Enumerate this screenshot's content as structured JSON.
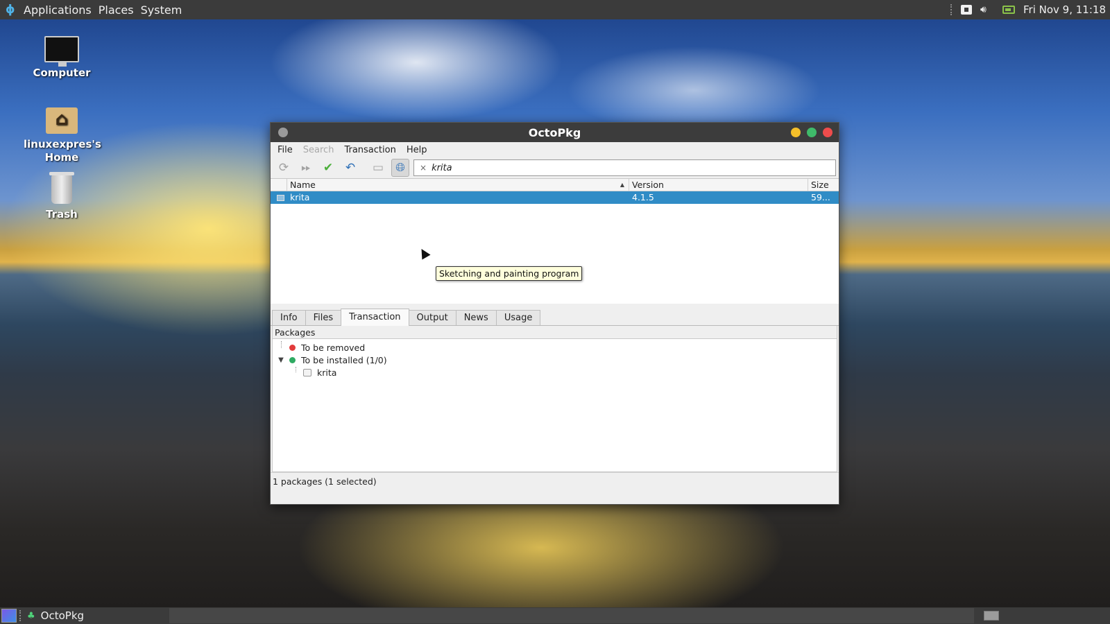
{
  "top_panel": {
    "menus": [
      "Applications",
      "Places",
      "System"
    ],
    "clock": "Fri Nov  9, 11:18",
    "icons": [
      "gecko-logo-icon",
      "notification-icon",
      "volume-icon",
      "battery-icon"
    ]
  },
  "desktop": {
    "icons": [
      {
        "label": "Computer",
        "icon": "computer-icon"
      },
      {
        "label": "linuxexpres's Home",
        "icon": "home-folder-icon"
      },
      {
        "label": "Trash",
        "icon": "trash-icon"
      }
    ]
  },
  "window": {
    "title": "OctoPkg",
    "menu": {
      "file": "File",
      "search": "Search",
      "transaction": "Transaction",
      "help": "Help"
    },
    "toolbar": {
      "icons": [
        "sync-icon",
        "stop-icon",
        "commit-icon",
        "rollback-icon",
        "terminal-icon",
        "aur-globe-icon"
      ],
      "search_value": "krita",
      "clear_symbol": "×"
    },
    "table": {
      "columns": {
        "name": "Name",
        "version": "Version",
        "size": "Size"
      },
      "rows": [
        {
          "name": "krita",
          "version": "4.1.5",
          "size": "59..."
        }
      ]
    },
    "tooltip": "Sketching and painting program",
    "tabs": [
      "Info",
      "Files",
      "Transaction",
      "Output",
      "News",
      "Usage"
    ],
    "active_tab": "Transaction",
    "transaction_pane": {
      "title": "Packages",
      "to_remove": "To be removed",
      "to_install": "To be installed (1/0)",
      "install_items": [
        "krita"
      ]
    },
    "status": "1 packages (1 selected)"
  },
  "taskbar": {
    "task_label": "OctoPkg"
  },
  "colors": {
    "selection": "#308cc6",
    "minimize": "#f4bf2a",
    "maximize": "#3fbb6a",
    "close": "#ee4c4c",
    "remove_dot": "#e23b3b",
    "install_dot": "#2faa62",
    "tooltip_bg": "#ffffdc"
  }
}
